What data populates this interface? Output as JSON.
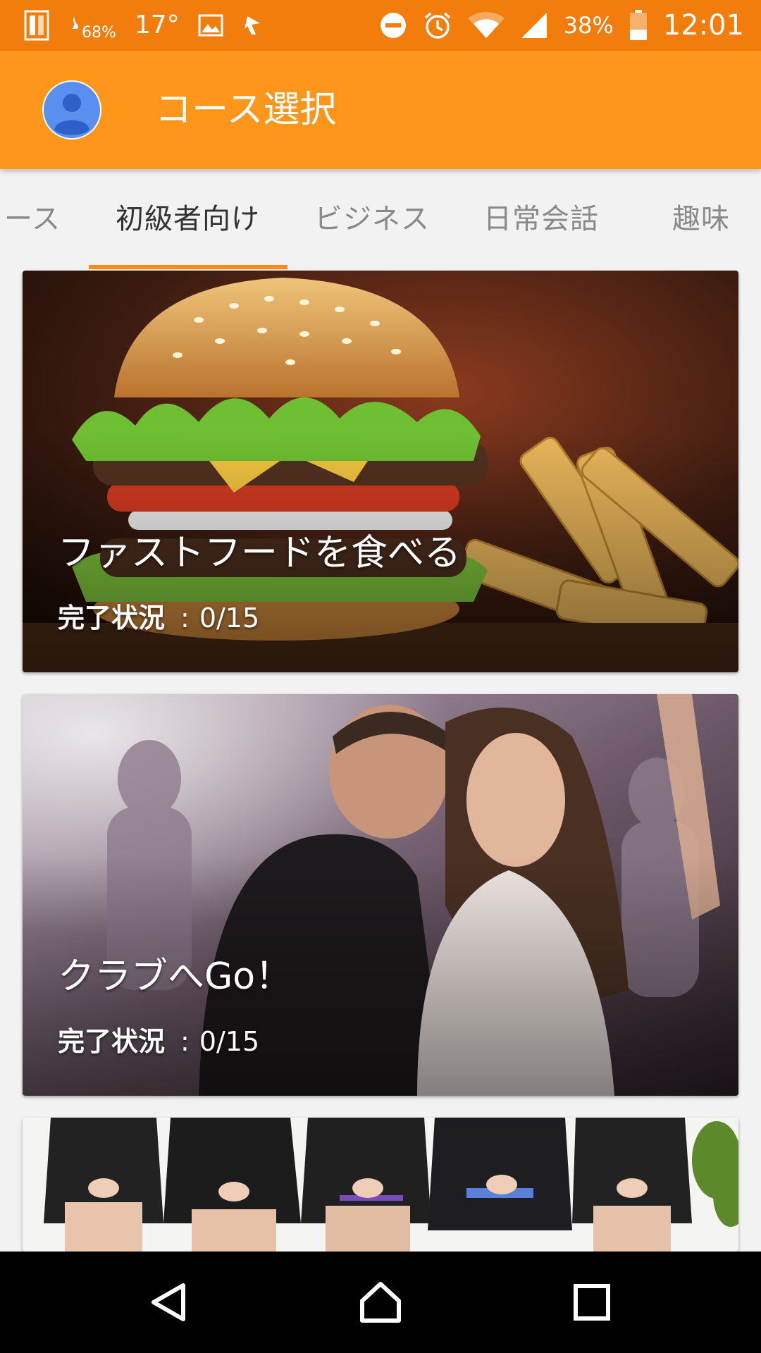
{
  "status_bar": {
    "left_icons": [
      "battery-saver-icon",
      "cpu-usage-icon",
      "image-notification-icon",
      "app-notification-icon"
    ],
    "cpu_percent": "68%",
    "temperature": "17°",
    "right_icons": [
      "do-not-disturb-icon",
      "alarm-icon",
      "wifi-icon",
      "cellular-signal-icon",
      "battery-icon"
    ],
    "battery_percent": "38%",
    "battery_level": 0.38,
    "time": "12:01",
    "background_color": "#f27d0c"
  },
  "app_bar": {
    "title": "コース選択",
    "avatar_icon": "account-avatar-icon",
    "background_color": "#fe961b"
  },
  "tabs": {
    "items": [
      {
        "label": "ース",
        "active": false
      },
      {
        "label": "初級者向け",
        "active": true
      },
      {
        "label": "ビジネス",
        "active": false
      },
      {
        "label": "日常会話",
        "active": false
      },
      {
        "label": "趣味",
        "active": false
      }
    ],
    "indicator_color": "#fe8b12"
  },
  "courses": [
    {
      "title": "ファストフードを食べる",
      "progress_label": "完了状況",
      "progress_separator": ":",
      "progress_value": "0/15",
      "image": "hamburger-and-fries-photo"
    },
    {
      "title": "クラブへGo！",
      "progress_label": "完了状況",
      "progress_separator": ":",
      "progress_value": "0/15",
      "image": "couple-at-club-photo"
    },
    {
      "title": "",
      "image": "business-people-seated-photo"
    }
  ],
  "nav_bar": {
    "icons": [
      "back-icon",
      "home-icon",
      "recents-icon"
    ]
  }
}
